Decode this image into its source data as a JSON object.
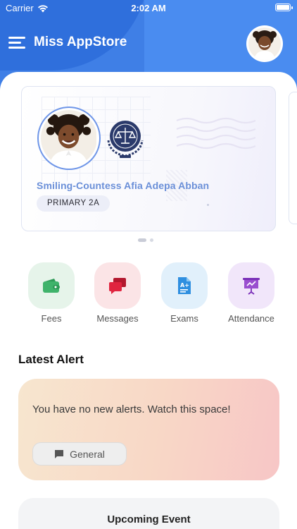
{
  "status_bar": {
    "carrier": "Carrier",
    "time": "2:02 AM"
  },
  "header": {
    "title": "Miss AppStore",
    "brand_color": "#3f7fe6"
  },
  "student_card": {
    "name": "Smiling-Countess Afia Adepa Abban",
    "class_label": "PRIMARY 2A",
    "accent": "#6a8fd8"
  },
  "carousel": {
    "pages": 2,
    "active_page": 1
  },
  "quick_actions": [
    {
      "label": "Fees",
      "icon": "wallet-icon",
      "bg": "#e6f4ea",
      "color": "#3fb36b"
    },
    {
      "label": "Messages",
      "icon": "chat-bubbles-icon",
      "bg": "#fbe4e6",
      "color": "#e0243f"
    },
    {
      "label": "Exams",
      "icon": "exam-document-icon",
      "bg": "#e1f0fb",
      "color": "#2f8fe0"
    },
    {
      "label": "Attendance",
      "icon": "presentation-board-icon",
      "bg": "#f1e6fa",
      "color": "#9a4fcf"
    }
  ],
  "alerts": {
    "section_title": "Latest Alert",
    "message": "You have no new alerts. Watch this space!",
    "tag_label": "General"
  },
  "events": {
    "title": "Upcoming Event"
  }
}
